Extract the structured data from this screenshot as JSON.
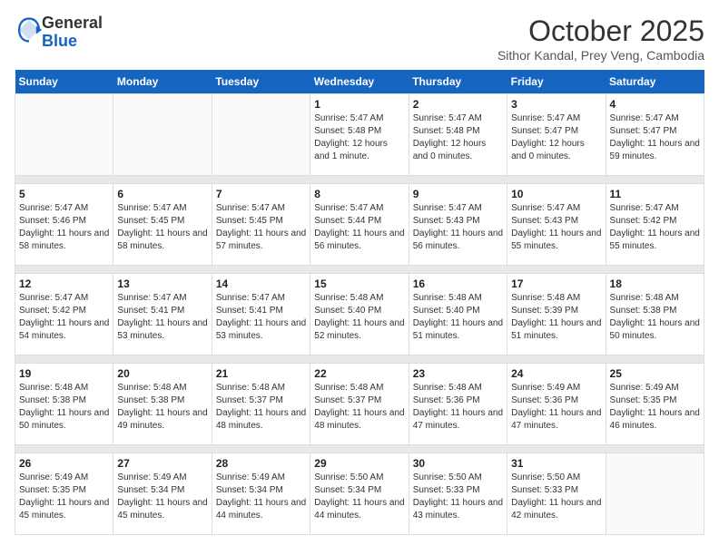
{
  "header": {
    "logo_general": "General",
    "logo_blue": "Blue",
    "title": "October 2025",
    "subtitle": "Sithor Kandal, Prey Veng, Cambodia"
  },
  "columns": [
    "Sunday",
    "Monday",
    "Tuesday",
    "Wednesday",
    "Thursday",
    "Friday",
    "Saturday"
  ],
  "weeks": [
    {
      "days": [
        {
          "num": "",
          "info": ""
        },
        {
          "num": "",
          "info": ""
        },
        {
          "num": "",
          "info": ""
        },
        {
          "num": "1",
          "info": "Sunrise: 5:47 AM\nSunset: 5:48 PM\nDaylight: 12 hours and 1 minute."
        },
        {
          "num": "2",
          "info": "Sunrise: 5:47 AM\nSunset: 5:48 PM\nDaylight: 12 hours and 0 minutes."
        },
        {
          "num": "3",
          "info": "Sunrise: 5:47 AM\nSunset: 5:47 PM\nDaylight: 12 hours and 0 minutes."
        },
        {
          "num": "4",
          "info": "Sunrise: 5:47 AM\nSunset: 5:47 PM\nDaylight: 11 hours and 59 minutes."
        }
      ]
    },
    {
      "days": [
        {
          "num": "5",
          "info": "Sunrise: 5:47 AM\nSunset: 5:46 PM\nDaylight: 11 hours and 58 minutes."
        },
        {
          "num": "6",
          "info": "Sunrise: 5:47 AM\nSunset: 5:45 PM\nDaylight: 11 hours and 58 minutes."
        },
        {
          "num": "7",
          "info": "Sunrise: 5:47 AM\nSunset: 5:45 PM\nDaylight: 11 hours and 57 minutes."
        },
        {
          "num": "8",
          "info": "Sunrise: 5:47 AM\nSunset: 5:44 PM\nDaylight: 11 hours and 56 minutes."
        },
        {
          "num": "9",
          "info": "Sunrise: 5:47 AM\nSunset: 5:43 PM\nDaylight: 11 hours and 56 minutes."
        },
        {
          "num": "10",
          "info": "Sunrise: 5:47 AM\nSunset: 5:43 PM\nDaylight: 11 hours and 55 minutes."
        },
        {
          "num": "11",
          "info": "Sunrise: 5:47 AM\nSunset: 5:42 PM\nDaylight: 11 hours and 55 minutes."
        }
      ]
    },
    {
      "days": [
        {
          "num": "12",
          "info": "Sunrise: 5:47 AM\nSunset: 5:42 PM\nDaylight: 11 hours and 54 minutes."
        },
        {
          "num": "13",
          "info": "Sunrise: 5:47 AM\nSunset: 5:41 PM\nDaylight: 11 hours and 53 minutes."
        },
        {
          "num": "14",
          "info": "Sunrise: 5:47 AM\nSunset: 5:41 PM\nDaylight: 11 hours and 53 minutes."
        },
        {
          "num": "15",
          "info": "Sunrise: 5:48 AM\nSunset: 5:40 PM\nDaylight: 11 hours and 52 minutes."
        },
        {
          "num": "16",
          "info": "Sunrise: 5:48 AM\nSunset: 5:40 PM\nDaylight: 11 hours and 51 minutes."
        },
        {
          "num": "17",
          "info": "Sunrise: 5:48 AM\nSunset: 5:39 PM\nDaylight: 11 hours and 51 minutes."
        },
        {
          "num": "18",
          "info": "Sunrise: 5:48 AM\nSunset: 5:38 PM\nDaylight: 11 hours and 50 minutes."
        }
      ]
    },
    {
      "days": [
        {
          "num": "19",
          "info": "Sunrise: 5:48 AM\nSunset: 5:38 PM\nDaylight: 11 hours and 50 minutes."
        },
        {
          "num": "20",
          "info": "Sunrise: 5:48 AM\nSunset: 5:38 PM\nDaylight: 11 hours and 49 minutes."
        },
        {
          "num": "21",
          "info": "Sunrise: 5:48 AM\nSunset: 5:37 PM\nDaylight: 11 hours and 48 minutes."
        },
        {
          "num": "22",
          "info": "Sunrise: 5:48 AM\nSunset: 5:37 PM\nDaylight: 11 hours and 48 minutes."
        },
        {
          "num": "23",
          "info": "Sunrise: 5:48 AM\nSunset: 5:36 PM\nDaylight: 11 hours and 47 minutes."
        },
        {
          "num": "24",
          "info": "Sunrise: 5:49 AM\nSunset: 5:36 PM\nDaylight: 11 hours and 47 minutes."
        },
        {
          "num": "25",
          "info": "Sunrise: 5:49 AM\nSunset: 5:35 PM\nDaylight: 11 hours and 46 minutes."
        }
      ]
    },
    {
      "days": [
        {
          "num": "26",
          "info": "Sunrise: 5:49 AM\nSunset: 5:35 PM\nDaylight: 11 hours and 45 minutes."
        },
        {
          "num": "27",
          "info": "Sunrise: 5:49 AM\nSunset: 5:34 PM\nDaylight: 11 hours and 45 minutes."
        },
        {
          "num": "28",
          "info": "Sunrise: 5:49 AM\nSunset: 5:34 PM\nDaylight: 11 hours and 44 minutes."
        },
        {
          "num": "29",
          "info": "Sunrise: 5:50 AM\nSunset: 5:34 PM\nDaylight: 11 hours and 44 minutes."
        },
        {
          "num": "30",
          "info": "Sunrise: 5:50 AM\nSunset: 5:33 PM\nDaylight: 11 hours and 43 minutes."
        },
        {
          "num": "31",
          "info": "Sunrise: 5:50 AM\nSunset: 5:33 PM\nDaylight: 11 hours and 42 minutes."
        },
        {
          "num": "",
          "info": ""
        }
      ]
    }
  ]
}
